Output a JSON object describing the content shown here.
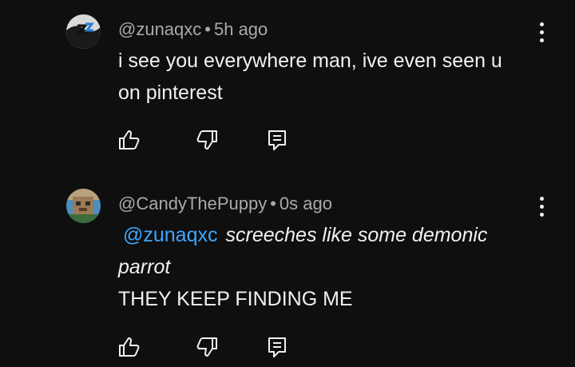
{
  "comments": [
    {
      "handle": "@zunaqxc",
      "separator": "•",
      "time": "5h ago",
      "text_line1": "i see you everywhere man, ive even seen u",
      "text_line2": "on pinterest"
    },
    {
      "handle": "@CandyThePuppy",
      "separator": "•",
      "time": "0s ago",
      "mention": "@zunaqxc",
      "italic_line1": "screeches like some demonic",
      "italic_line2": "parrot",
      "text_line3": "THEY KEEP FINDING ME"
    }
  ],
  "icons": {
    "like": "thumb-up-icon",
    "dislike": "thumb-down-icon",
    "reply": "reply-icon",
    "menu": "more-vert-icon"
  },
  "colors": {
    "background": "#0f0f0f",
    "text": "#f1f1f1",
    "meta": "#aaaaaa",
    "mention": "#3ea6ff"
  }
}
